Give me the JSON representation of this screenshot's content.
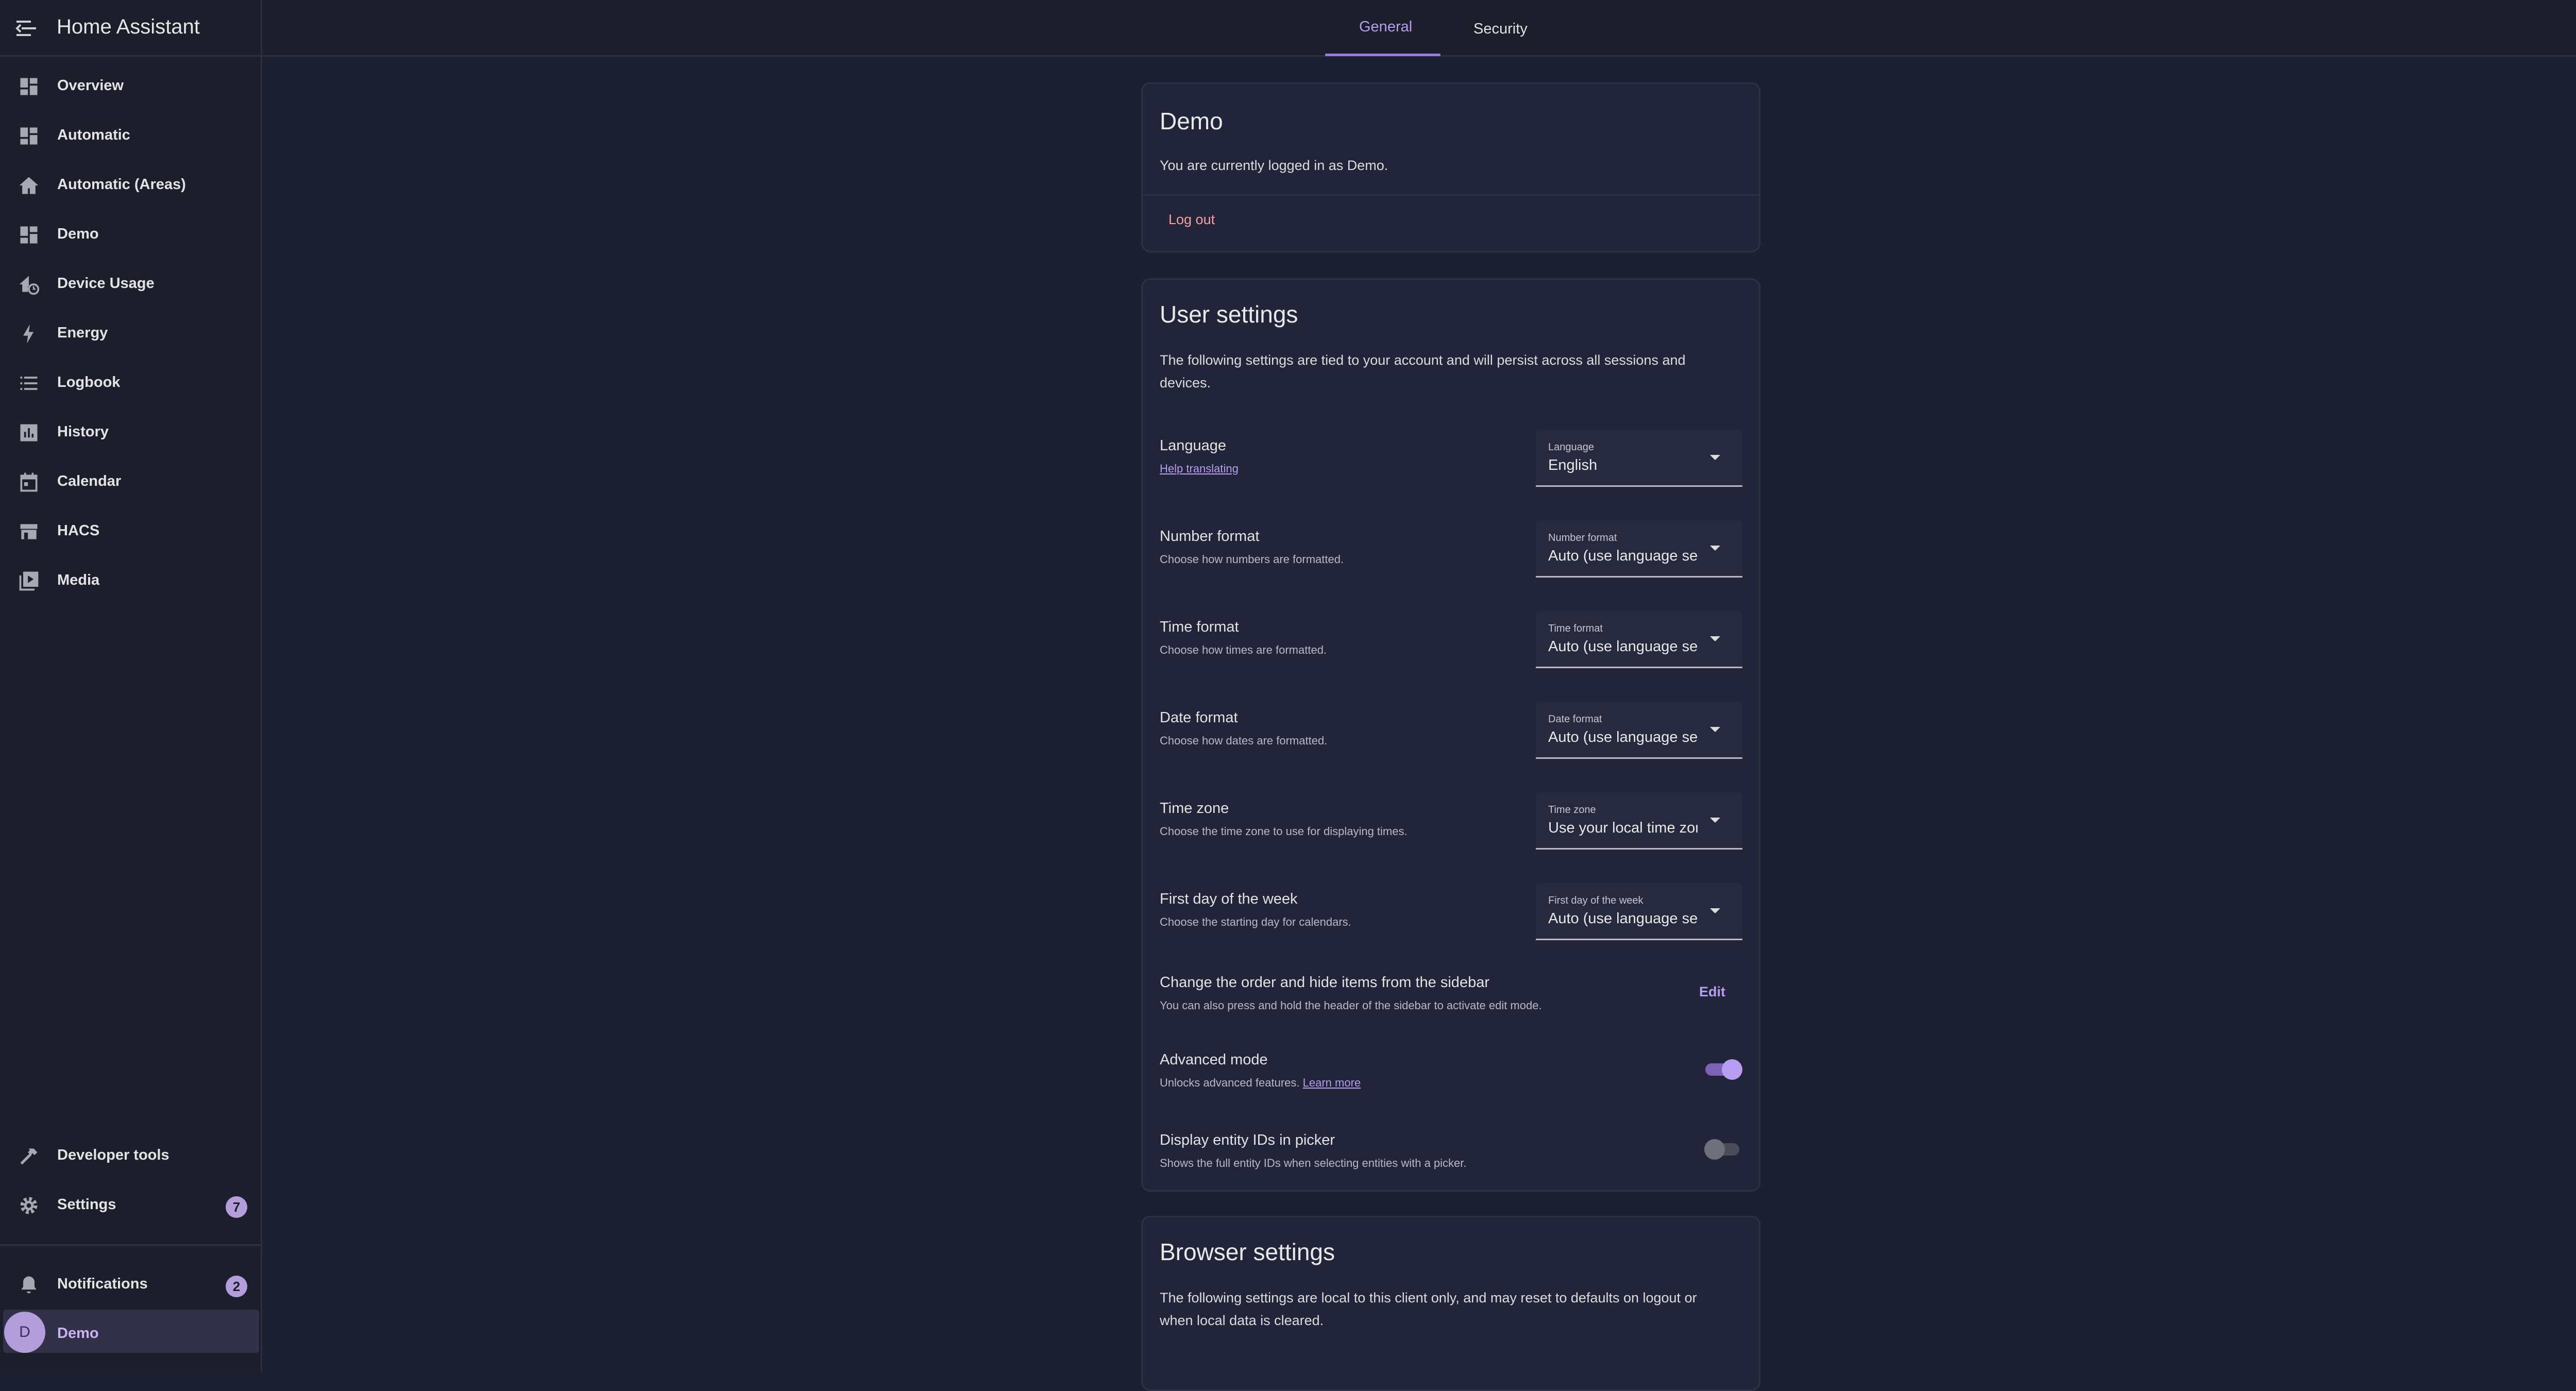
{
  "app": {
    "title": "Home Assistant"
  },
  "sidebar": {
    "items": [
      {
        "label": "Overview",
        "icon": "dashboard-icon"
      },
      {
        "label": "Automatic",
        "icon": "dashboard-icon"
      },
      {
        "label": "Automatic (Areas)",
        "icon": "home-icon"
      },
      {
        "label": "Demo",
        "icon": "dashboard-icon"
      },
      {
        "label": "Device Usage",
        "icon": "home-clock-icon"
      },
      {
        "label": "Energy",
        "icon": "lightning-icon"
      },
      {
        "label": "Logbook",
        "icon": "list-icon"
      },
      {
        "label": "History",
        "icon": "chart-icon"
      },
      {
        "label": "Calendar",
        "icon": "calendar-icon"
      },
      {
        "label": "HACS",
        "icon": "store-icon"
      },
      {
        "label": "Media",
        "icon": "play-box-icon"
      }
    ],
    "developer_tools": "Developer tools",
    "settings": {
      "label": "Settings",
      "badge": "7"
    },
    "notifications": {
      "label": "Notifications",
      "badge": "2"
    },
    "user": {
      "initial": "D",
      "name": "Demo"
    }
  },
  "tabs": [
    {
      "label": "General",
      "active": true
    },
    {
      "label": "Security",
      "active": false
    }
  ],
  "account_card": {
    "title": "Demo",
    "text": "You are currently logged in as Demo.",
    "logout": "Log out"
  },
  "user_settings": {
    "title": "User settings",
    "intro": "The following settings are tied to your account and will persist across all sessions and devices.",
    "language": {
      "title": "Language",
      "link": "Help translating",
      "select_label": "Language",
      "value": "English"
    },
    "number_format": {
      "title": "Number format",
      "desc": "Choose how numbers are formatted.",
      "select_label": "Number format",
      "value": "Auto (use language setting)"
    },
    "time_format": {
      "title": "Time format",
      "desc": "Choose how times are formatted.",
      "select_label": "Time format",
      "value": "Auto (use language setting)"
    },
    "date_format": {
      "title": "Date format",
      "desc": "Choose how dates are formatted.",
      "select_label": "Date format",
      "value": "Auto (use language setting)"
    },
    "time_zone": {
      "title": "Time zone",
      "desc": "Choose the time zone to use for displaying times.",
      "select_label": "Time zone",
      "value": "Use your local time zone"
    },
    "first_day": {
      "title": "First day of the week",
      "desc": "Choose the starting day for calendars.",
      "select_label": "First day of the week",
      "value": "Auto (use language setting)"
    },
    "sidebar_order": {
      "title": "Change the order and hide items from the sidebar",
      "desc": "You can also press and hold the header of the sidebar to activate edit mode.",
      "button": "Edit"
    },
    "advanced_mode": {
      "title": "Advanced mode",
      "desc": "Unlocks advanced features.",
      "link": "Learn more",
      "enabled": true
    },
    "entity_ids": {
      "title": "Display entity IDs in picker",
      "desc": "Shows the full entity IDs when selecting entities with a picker.",
      "enabled": false
    }
  },
  "browser_settings": {
    "title": "Browser settings",
    "intro": "The following settings are local to this client only, and may reset to defaults on logout or when local data is cleared."
  },
  "colors": {
    "accent": "#b79df0",
    "background": "#1d2031",
    "sidebar": "#1c1e2b",
    "card": "#22253a",
    "logout": "#f4a0a0"
  }
}
